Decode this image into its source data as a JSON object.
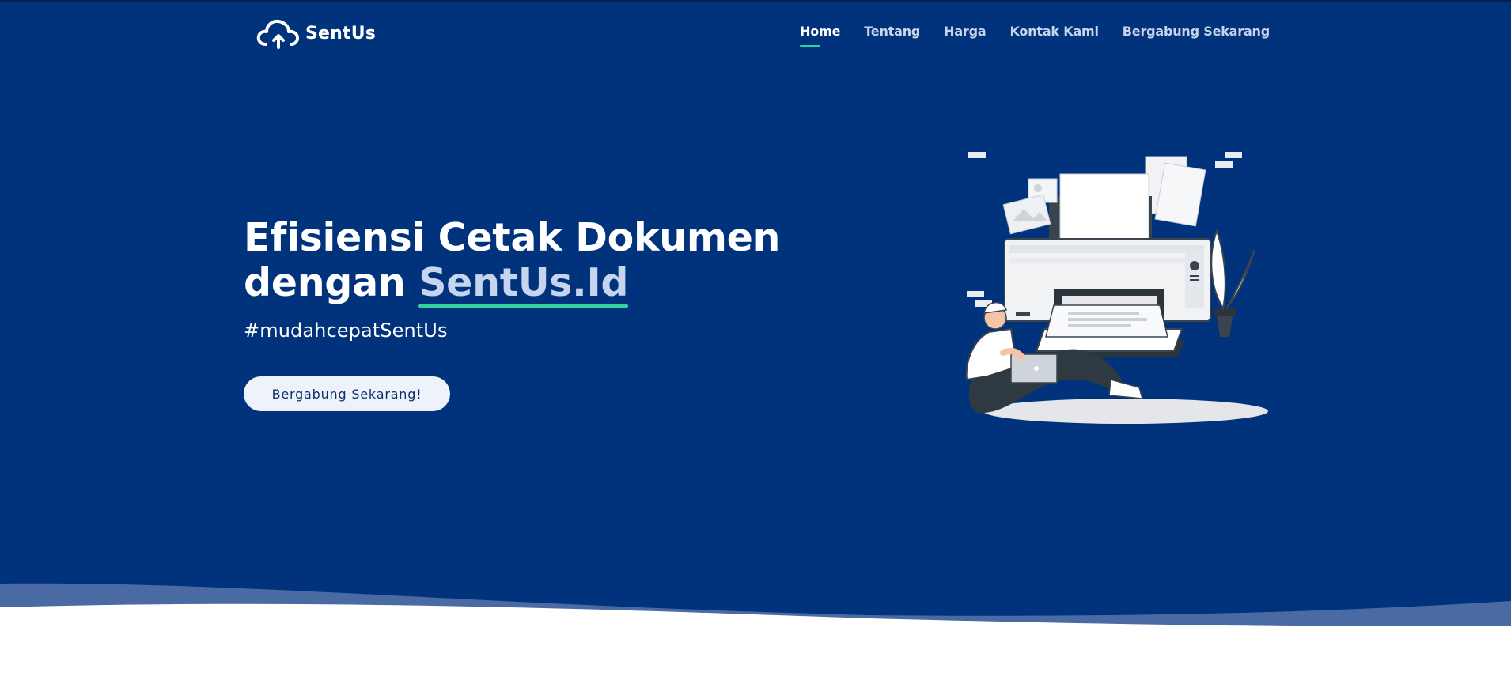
{
  "colors": {
    "hero_bg": "#01337d",
    "accent_underline": "#2fd3a1",
    "button_bg": "#eef3fb",
    "button_text": "#0b2f6e",
    "wave_light": "#4a6aa4"
  },
  "brand": {
    "name": "SentUs",
    "icon": "cloud-upload-icon"
  },
  "nav": {
    "items": [
      {
        "label": "Home",
        "active": true
      },
      {
        "label": "Tentang",
        "active": false
      },
      {
        "label": "Harga",
        "active": false
      },
      {
        "label": "Kontak Kami",
        "active": false
      },
      {
        "label": "Bergabung Sekarang",
        "active": false
      }
    ]
  },
  "hero": {
    "headline_line1": "Efisiensi Cetak Dokumen",
    "headline_line2_prefix": "dengan ",
    "headline_accent": "SentUs.Id",
    "tagline": "#mudahcepatSentUs",
    "cta_label": "Bergabung Sekarang!",
    "illustration_icon": "printer-illustration-icon"
  }
}
